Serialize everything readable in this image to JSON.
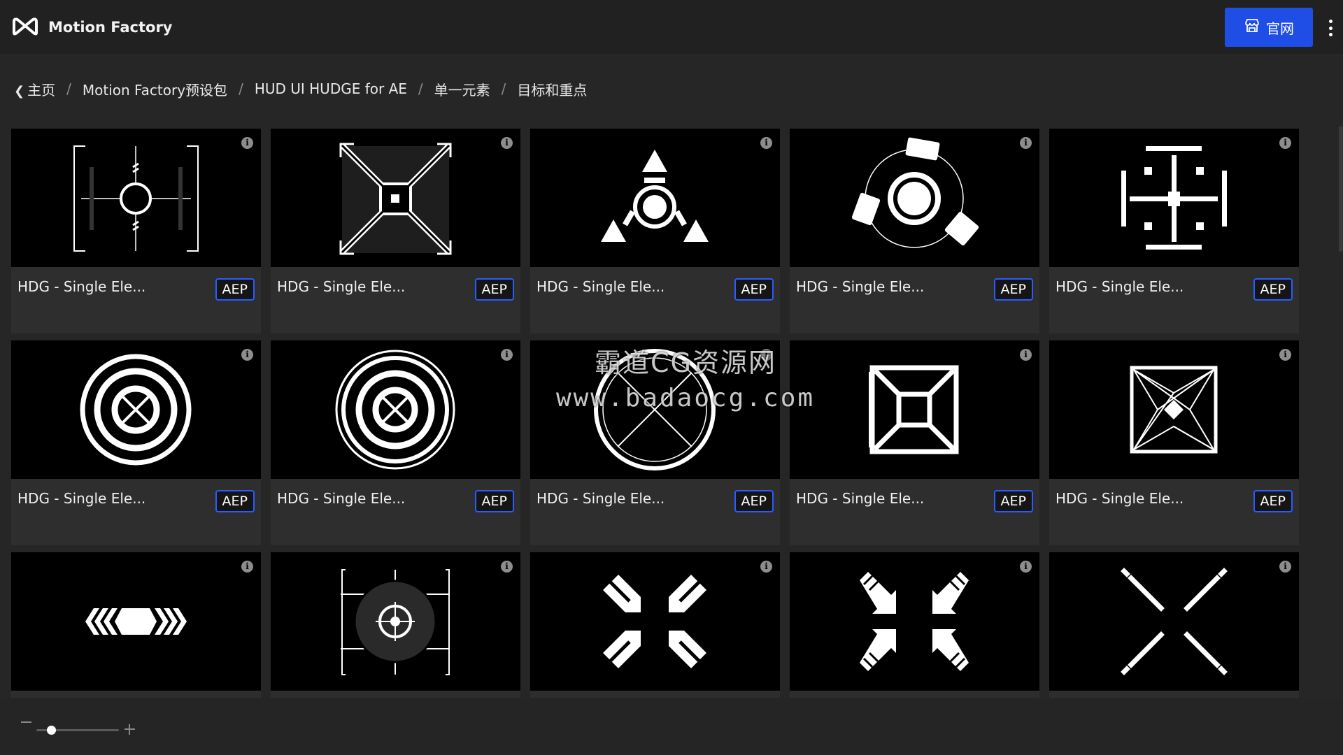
{
  "app": {
    "name": "Motion Factory",
    "logo_icon": "motion-factory-logo-icon",
    "site_button_label": "官网",
    "site_button_icon": "store-icon",
    "accent_color": "#1f4ee6"
  },
  "breadcrumb": {
    "back_icon": "chevron-left-icon",
    "items": [
      "主页",
      "Motion Factory预设包",
      "HUD UI HUDGE for AE",
      "单一元素",
      "目标和重点"
    ],
    "separator": "/"
  },
  "watermark": {
    "line1": "霸道CG资源网",
    "line2": "www.badaocg.com"
  },
  "cards": [
    {
      "title": "HDG - Single Ele...",
      "badge": "AEP",
      "icon": "crosshair-bracket-icon"
    },
    {
      "title": "HDG - Single Ele...",
      "badge": "AEP",
      "icon": "frame-square-x-icon"
    },
    {
      "title": "HDG - Single Ele...",
      "badge": "AEP",
      "icon": "triangle-ring-icon"
    },
    {
      "title": "HDG - Single Ele...",
      "badge": "AEP",
      "icon": "orbit-segments-icon"
    },
    {
      "title": "HDG - Single Ele...",
      "badge": "AEP",
      "icon": "grid-cross-icon"
    },
    {
      "title": "HDG - Single Ele...",
      "badge": "AEP",
      "icon": "concentric-target-icon"
    },
    {
      "title": "HDG - Single Ele...",
      "badge": "AEP",
      "icon": "concentric-target-ticks-icon"
    },
    {
      "title": "HDG - Single Ele...",
      "badge": "AEP",
      "icon": "circle-x-icon"
    },
    {
      "title": "HDG - Single Ele...",
      "badge": "AEP",
      "icon": "nested-square-icon"
    },
    {
      "title": "HDG - Single Ele...",
      "badge": "AEP",
      "icon": "star-square-icon"
    },
    {
      "title": "",
      "badge": "",
      "icon": "chevron-hexagon-icon"
    },
    {
      "title": "",
      "badge": "",
      "icon": "disc-crosshair-icon"
    },
    {
      "title": "",
      "badge": "",
      "icon": "inward-blocks-icon"
    },
    {
      "title": "",
      "badge": "",
      "icon": "inward-arrows-icon"
    },
    {
      "title": "",
      "badge": "",
      "icon": "dashed-x-icon"
    }
  ],
  "info_icon": "info-icon",
  "zoom": {
    "minus_icon": "minus-icon",
    "plus_icon": "plus-icon",
    "level": 0.18
  }
}
